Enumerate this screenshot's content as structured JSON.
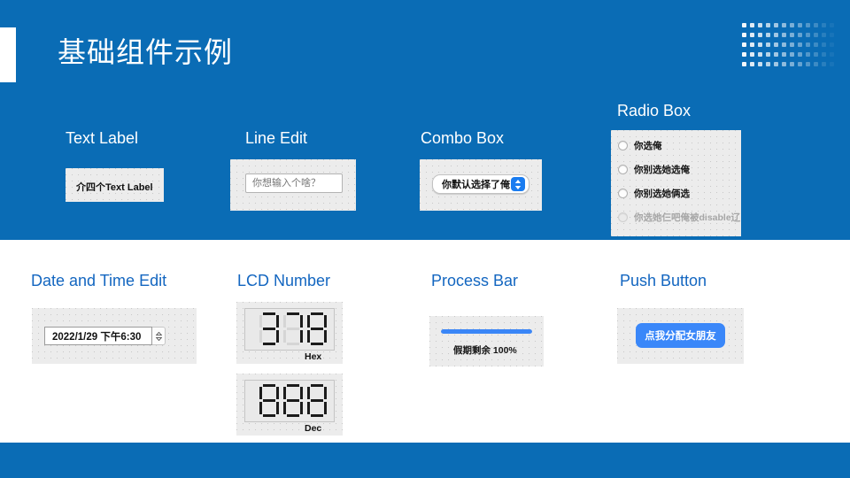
{
  "slide": {
    "title": "基础组件示例",
    "accent_blue": "#0a6cb5",
    "heading_blue": "#1366c0",
    "widget_blue": "#3a87f9"
  },
  "sections": {
    "text_label": {
      "heading": "Text Label",
      "value": "介四个Text Label"
    },
    "line_edit": {
      "heading": "Line Edit",
      "placeholder": "你想输入个啥？",
      "value": ""
    },
    "combo_box": {
      "heading": "Combo Box",
      "selected": "你默认选择了俺",
      "stepper_icon": "chevron-up-down-icon"
    },
    "radio_box": {
      "heading": "Radio Box",
      "options": [
        {
          "label": "你选俺",
          "checked": false,
          "disabled": false
        },
        {
          "label": "你别选她选俺",
          "checked": false,
          "disabled": false
        },
        {
          "label": "你别选她俩选",
          "checked": false,
          "disabled": false
        },
        {
          "label": "你选她仨吧俺被disable辽",
          "checked": false,
          "disabled": true
        }
      ]
    },
    "date_time_edit": {
      "heading": "Date and Time Edit",
      "value": "2022/1/29 下午6:30",
      "spinner_icon": "spinner-arrows-icon"
    },
    "lcd_number": {
      "heading": "LCD Number",
      "displays": [
        {
          "value": "378",
          "caption": "Hex"
        },
        {
          "value": "888",
          "caption": "Dec"
        }
      ]
    },
    "process_bar": {
      "heading": "Process Bar",
      "percent": 100,
      "label": "假期剩余 100%"
    },
    "push_button": {
      "heading": "Push Button",
      "label": "点我分配女朋友"
    }
  }
}
